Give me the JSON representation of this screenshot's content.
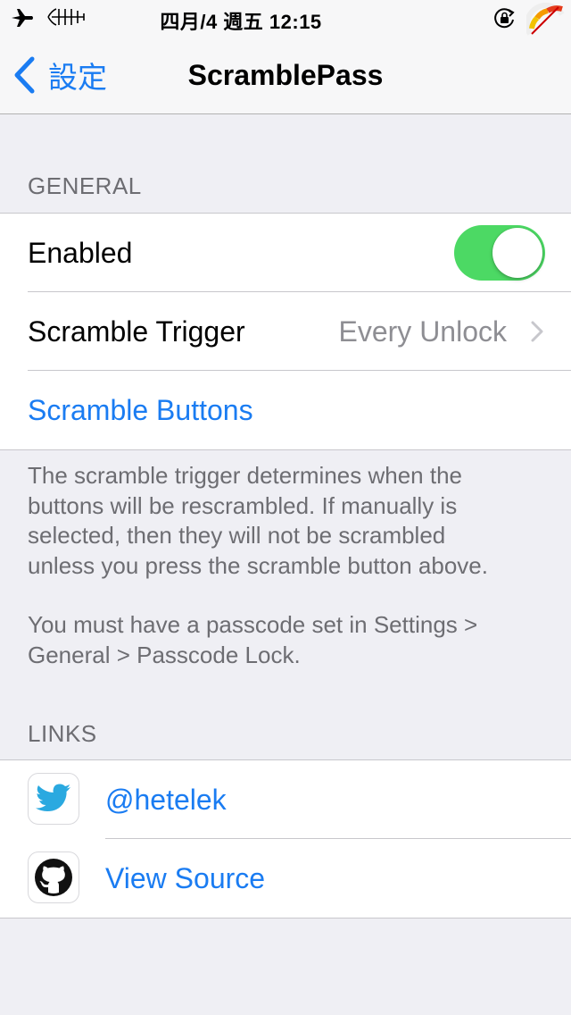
{
  "status_bar": {
    "time": "四月/4 週五 12:15",
    "icons": [
      "airplane-icon",
      "fishbone-icon",
      "rotation-lock-icon",
      "gauge-icon"
    ]
  },
  "nav": {
    "back_label": "設定",
    "title": "ScramblePass"
  },
  "general": {
    "header": "GENERAL",
    "enabled_label": "Enabled",
    "enabled": true,
    "trigger_label": "Scramble Trigger",
    "trigger_value": "Every Unlock",
    "scramble_buttons_label": "Scramble Buttons",
    "footer_paragraph_1_lines": [
      "The scramble trigger determines when the",
      "buttons will be rescrambled. If manually is",
      "selected, then they will not be scrambled",
      "unless you press the scramble button above."
    ],
    "footer_paragraph_2_lines": [
      "You must have a passcode set in Settings >",
      "General > Passcode Lock."
    ]
  },
  "links": {
    "header": "LINKS",
    "items": [
      {
        "label": "@hetelek",
        "icon": "twitter-icon"
      },
      {
        "label": "View Source",
        "icon": "github-icon"
      }
    ]
  },
  "colors": {
    "accent": "#1a7cf2",
    "toggle_on": "#4cd964",
    "background": "#efeff4",
    "secondary_text": "#6d6d72"
  }
}
